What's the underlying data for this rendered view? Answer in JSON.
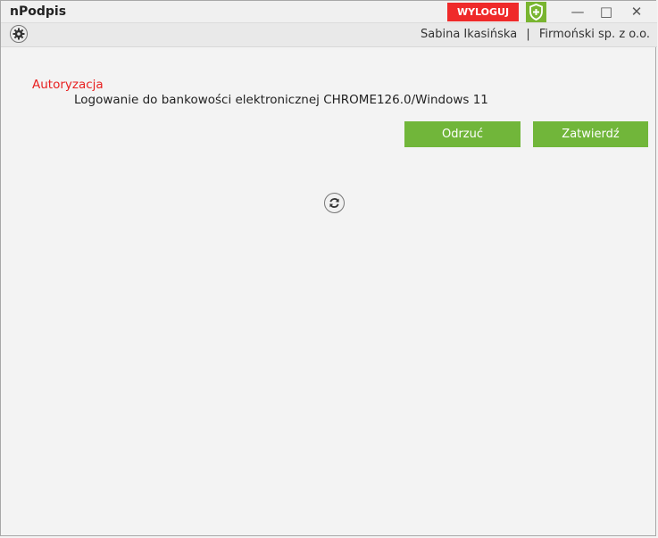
{
  "window": {
    "title": "nPodpis",
    "logout_label": "WYLOGUJ",
    "minimize_glyph": "—",
    "maximize_glyph": "□",
    "close_glyph": "✕"
  },
  "toolbar": {
    "user_name": "Sabina Ikasińska",
    "separator": "|",
    "company": "Firmoński sp. z o.o."
  },
  "authorization": {
    "title": "Autoryzacja",
    "description": "Logowanie do bankowości elektronicznej CHROME126.0/Windows 11",
    "reject_label": "Odrzuć",
    "confirm_label": "Zatwierdź"
  },
  "colors": {
    "logout_red": "#ef2a2a",
    "accent_green": "#71b63a",
    "shield_green": "#79b530",
    "title_red": "#e82020"
  },
  "icons": [
    "settings-gear-icon",
    "security-shield-icon",
    "refresh-icon"
  ]
}
